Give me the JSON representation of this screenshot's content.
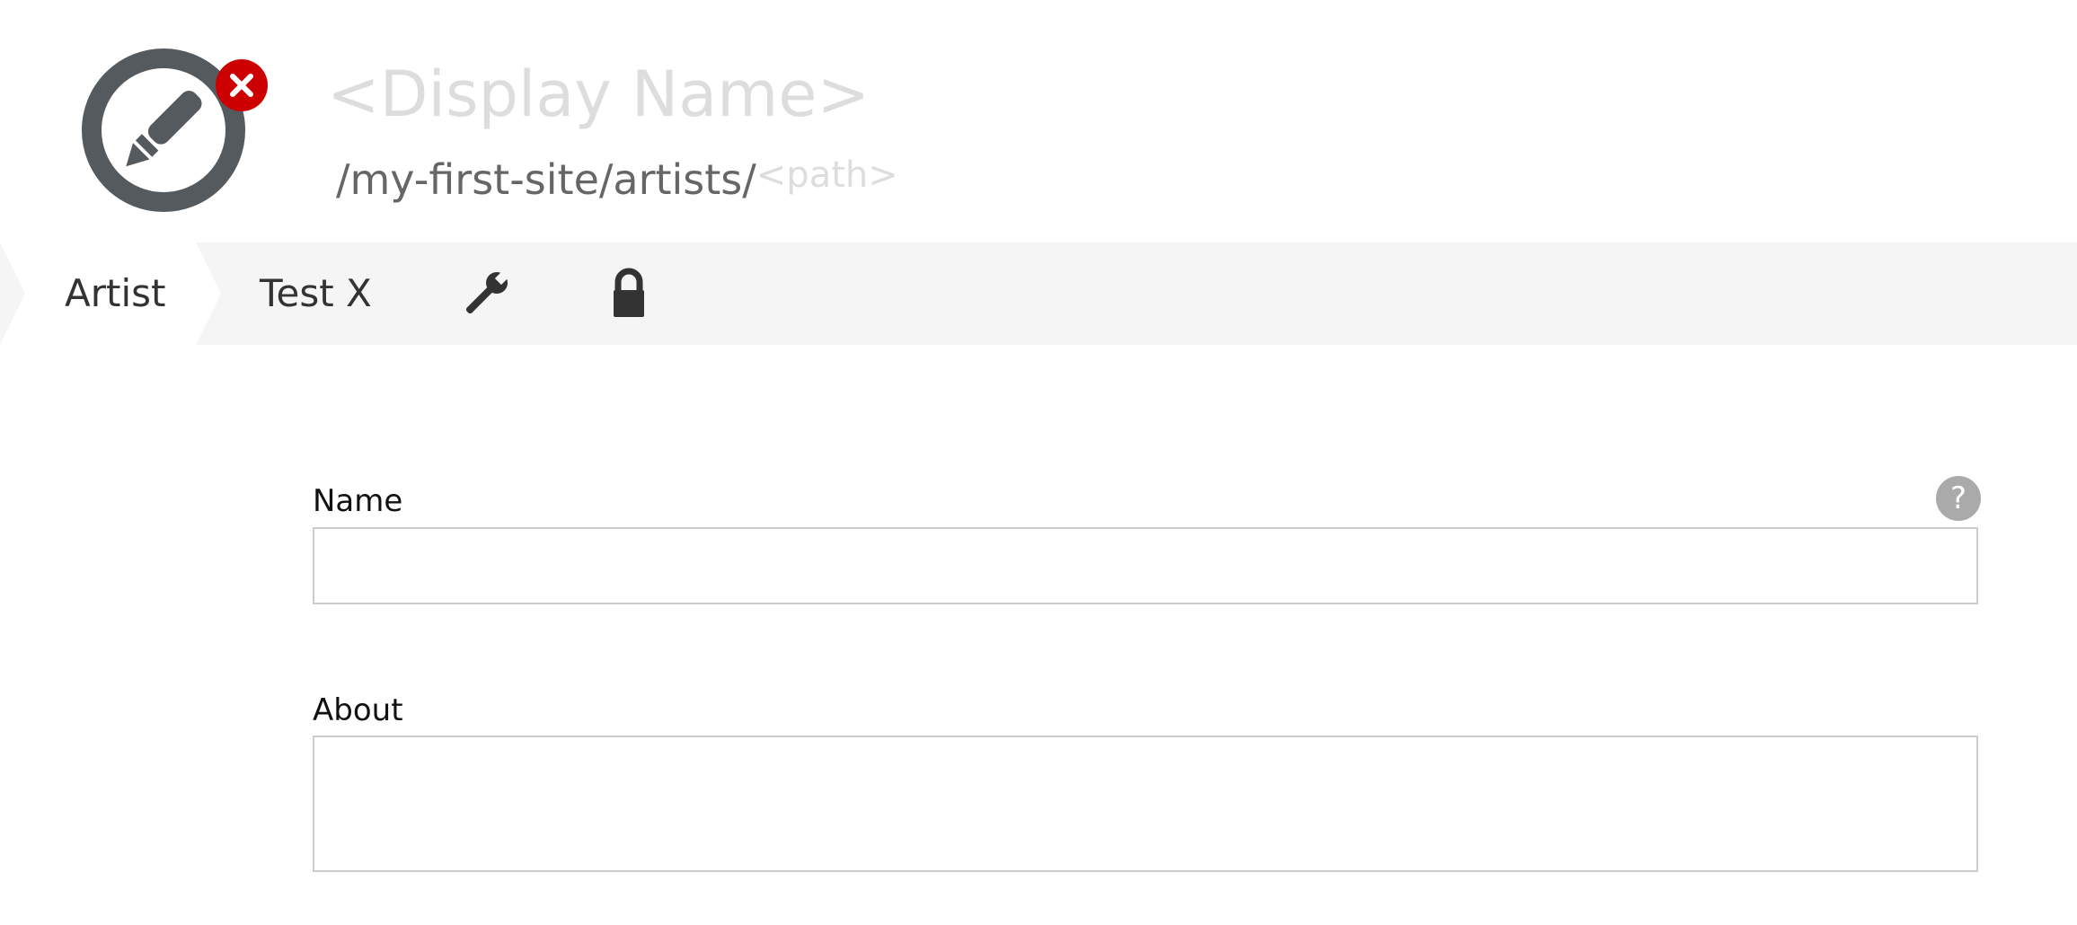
{
  "header": {
    "icon": "edit-pencil-icon",
    "status_badge_icon": "close-icon",
    "display_name_placeholder": "<Display Name>",
    "path_prefix": "/my-first-site/artists/",
    "path_placeholder": "<path>"
  },
  "tabs": [
    {
      "label": "Artist",
      "active": true
    },
    {
      "label": "Test X",
      "active": false
    },
    {
      "icon": "wrench-icon"
    },
    {
      "icon": "lock-icon"
    }
  ],
  "form": {
    "name": {
      "label": "Name",
      "value": ""
    },
    "about": {
      "label": "About",
      "value": ""
    },
    "help_label": "?"
  },
  "colors": {
    "icon_dark": "#555a5f",
    "error_red": "#cc0000",
    "placeholder_gray": "#dddddd",
    "tab_bar_bg": "#f5f5f5",
    "input_border": "#cccccc",
    "help_bg": "#aaaaaa"
  }
}
